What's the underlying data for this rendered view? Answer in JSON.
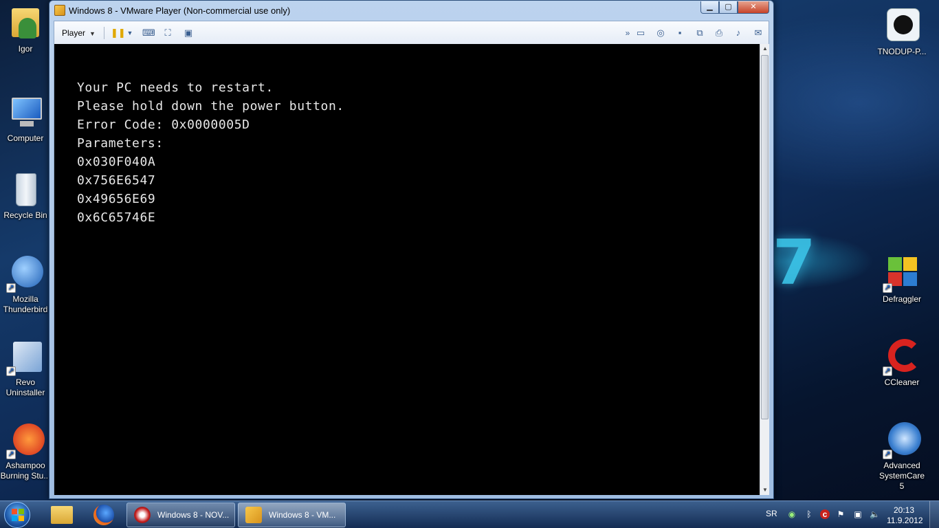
{
  "desktop": {
    "left_icons": [
      {
        "label": "Igor"
      },
      {
        "label": "Computer"
      },
      {
        "label": "Recycle Bin"
      },
      {
        "label": "Mozilla Thunderbird"
      },
      {
        "label": "Revo Uninstaller"
      },
      {
        "label": "Ashampoo Burning Stu..."
      }
    ],
    "right_icons": [
      {
        "label": "TNODUP-P..."
      },
      {
        "label": "Defraggler"
      },
      {
        "label": "CCleaner"
      },
      {
        "label": "Advanced SystemCare 5"
      }
    ]
  },
  "window": {
    "title": "Windows 8 - VMware Player (Non-commercial use only)",
    "toolbar": {
      "player_label": "Player"
    }
  },
  "vm_console": {
    "lines": [
      "Your PC needs to restart.",
      "Please hold down the power button.",
      "Error Code: 0x0000005D",
      "Parameters:",
      "0x030F040A",
      "0x756E6547",
      "0x49656E69",
      "0x6C65746E"
    ]
  },
  "taskbar": {
    "buttons": [
      {
        "label": "Windows 8 - NOV..."
      },
      {
        "label": "Windows 8 - VM..."
      }
    ],
    "tray": {
      "language": "SR",
      "time": "20:13",
      "date": "11.9.2012"
    }
  },
  "colors": {
    "console_bg": "#000000",
    "console_text": "#e8e8e8",
    "desktop_accent": "#3cc6ea"
  }
}
